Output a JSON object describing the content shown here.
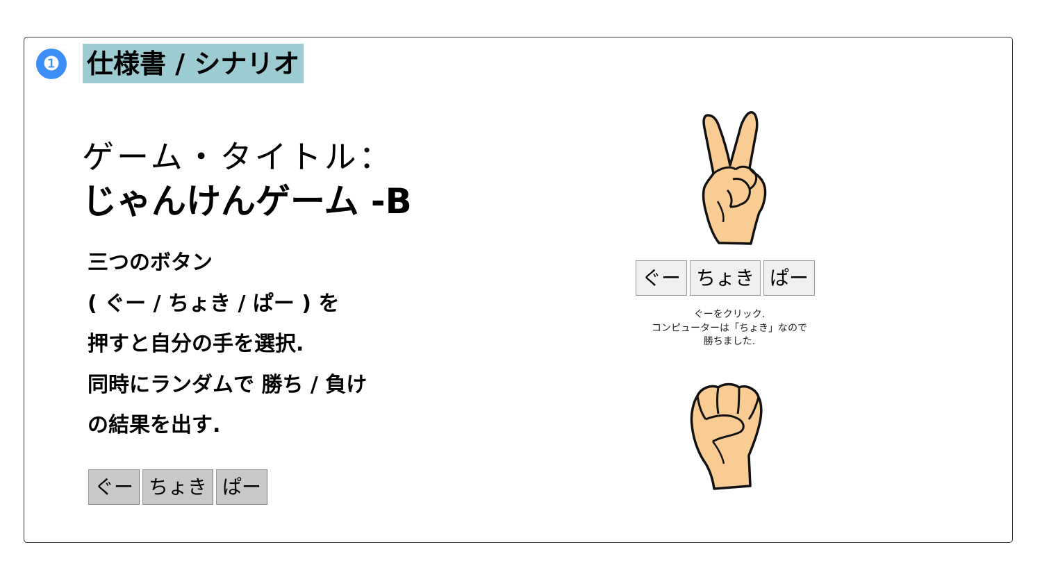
{
  "section": {
    "number": "❶",
    "title": "仕様書 / シナリオ"
  },
  "game": {
    "label": "ゲーム・タイトル：",
    "name": "じゃんけんゲーム -B"
  },
  "description": [
    "三つのボタン",
    "( ぐー / ちょき / ぱー ) を",
    "押すと自分の手を選択.",
    "同時にランダムで 勝ち / 負け",
    "の結果を出す."
  ],
  "buttons": {
    "rock": "ぐー",
    "scissors": "ちょき",
    "paper": "ぱー"
  },
  "demo": {
    "computer_hand_icon": "peace-hand-icon",
    "player_hand_icon": "fist-hand-icon",
    "result_lines": [
      "ぐーをクリック.",
      "コンピューターは「ちょき」なので",
      "勝ちました."
    ]
  },
  "colors": {
    "title_highlight": "#9ccbd1",
    "badge": "#3a8ef6",
    "skin": "#f9cc94",
    "left_button": "#c9c9c9",
    "right_button": "#f0f0f0"
  }
}
